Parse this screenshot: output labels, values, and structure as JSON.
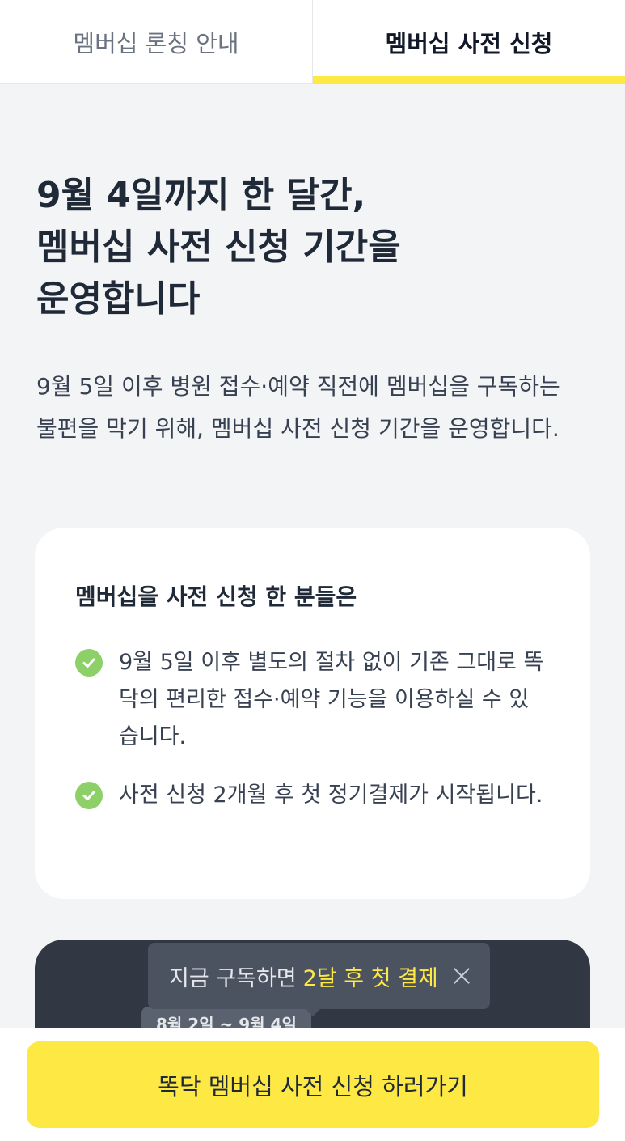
{
  "tabs": [
    {
      "label": "멤버십 론칭 안내",
      "active": false
    },
    {
      "label": "멤버십 사전 신청",
      "active": true
    }
  ],
  "headline": "9월 4일까지 한 달간,\n멤버십 사전 신청 기간을\n운영합니다",
  "description": "9월 5일 이후 병원 접수·예약 직전에 멤버십을 구독하는 불편을 막기 위해, 멤버십 사전 신청 기간을 운영합니다.",
  "benefits_card": {
    "title": "멤버십을 사전 신청 한 분들은",
    "items": [
      "9월 5일 이후 별도의 절차 없이 기존 그대로 똑닥의 편리한 접수·예약 기능을 이용하실 수 있습니다.",
      "사전 신청 2개월 후 첫 정기결제가 시작됩니다."
    ]
  },
  "tooltip": {
    "prefix": "지금 구독하면",
    "highlight": "2달 후 첫 결제"
  },
  "date_chip": "8월 2일 ~ 9월 4일",
  "cta": {
    "label": "똑닥 멤버십 사전 신청 하러가기"
  },
  "colors": {
    "accent": "#fde844",
    "check": "#8dd067",
    "dark_card": "#323843",
    "background": "#f3f4f6"
  }
}
